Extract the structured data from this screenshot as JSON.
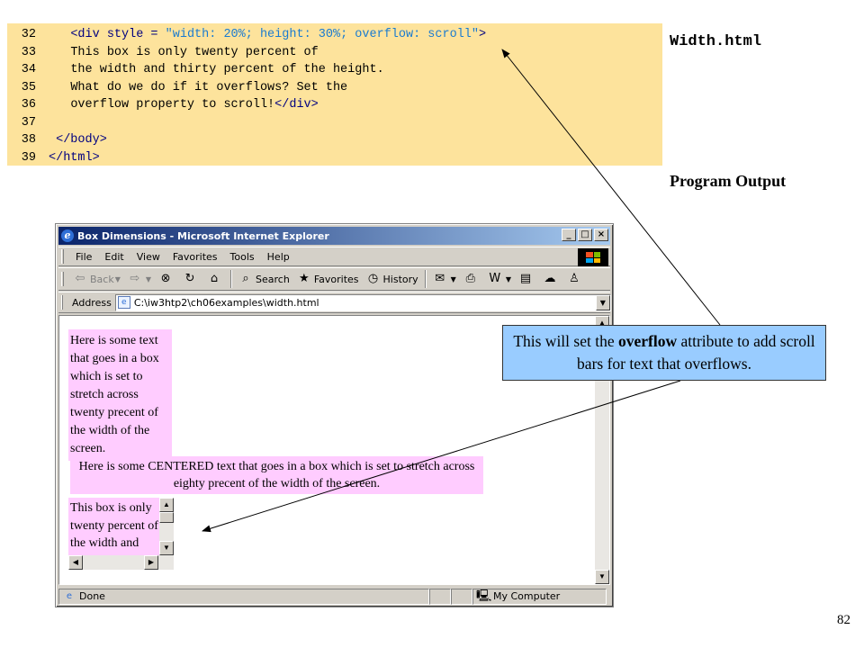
{
  "slide": {
    "file_label": "Width.html",
    "program_output_label": "Program Output",
    "page_number": "82"
  },
  "code_listing": {
    "lines": [
      {
        "number": "32",
        "indent": "   ",
        "tokens": [
          {
            "t": "tag",
            "v": "<div style = "
          },
          {
            "t": "str",
            "v": "\"width: 20%; height: 30%; overflow: scroll\""
          },
          {
            "t": "tag",
            "v": ">"
          }
        ]
      },
      {
        "number": "33",
        "indent": "   ",
        "tokens": [
          {
            "t": "txt",
            "v": "This box is only twenty percent of"
          }
        ]
      },
      {
        "number": "34",
        "indent": "   ",
        "tokens": [
          {
            "t": "txt",
            "v": "the width and thirty percent of the height."
          }
        ]
      },
      {
        "number": "35",
        "indent": "   ",
        "tokens": [
          {
            "t": "txt",
            "v": "What do we do if it overflows? Set the"
          }
        ]
      },
      {
        "number": "36",
        "indent": "   ",
        "tokens": [
          {
            "t": "txt",
            "v": "overflow property to scroll!"
          },
          {
            "t": "tag",
            "v": "</div>"
          }
        ]
      },
      {
        "number": "37",
        "indent": "",
        "tokens": []
      },
      {
        "number": "38",
        "indent": " ",
        "tokens": [
          {
            "t": "tag",
            "v": "</body>"
          }
        ]
      },
      {
        "number": "39",
        "indent": "",
        "tokens": [
          {
            "t": "tag",
            "v": "</html>"
          }
        ]
      }
    ]
  },
  "browser": {
    "title": "Box Dimensions - Microsoft Internet Explorer",
    "window_buttons": {
      "minimize": "_",
      "maximize": "□",
      "close": "×"
    },
    "menu": [
      "File",
      "Edit",
      "View",
      "Favorites",
      "Tools",
      "Help"
    ],
    "toolbar": {
      "back": "Back",
      "search": "Search",
      "favorites": "Favorites",
      "history": "History"
    },
    "address_label": "Address",
    "address_value": "C:\\iw3htp2\\ch06examples\\width.html",
    "content": {
      "box1": "Here is some text that goes in a box which is set to stretch across twenty precent of the width of the screen.",
      "box2": "Here is some CENTERED text that goes in a box which is set to stretch across eighty precent of the width of the screen.",
      "box3": "This box is only twenty percent of the width and thirty percent of the height."
    },
    "status_text": "Done",
    "status_zone": "My Computer"
  },
  "callout": {
    "pre": "This will set the ",
    "bold": "overflow",
    "post": " attribute to add scroll bars for text that overflows."
  },
  "colors": {
    "code_background": "#fde39c",
    "code_tag": "#000080",
    "code_string": "#1a7bd0",
    "box_background": "#ffccff",
    "callout_background": "#99ccff",
    "titlebar_start": "#0a246a",
    "titlebar_end": "#a6caf0"
  }
}
